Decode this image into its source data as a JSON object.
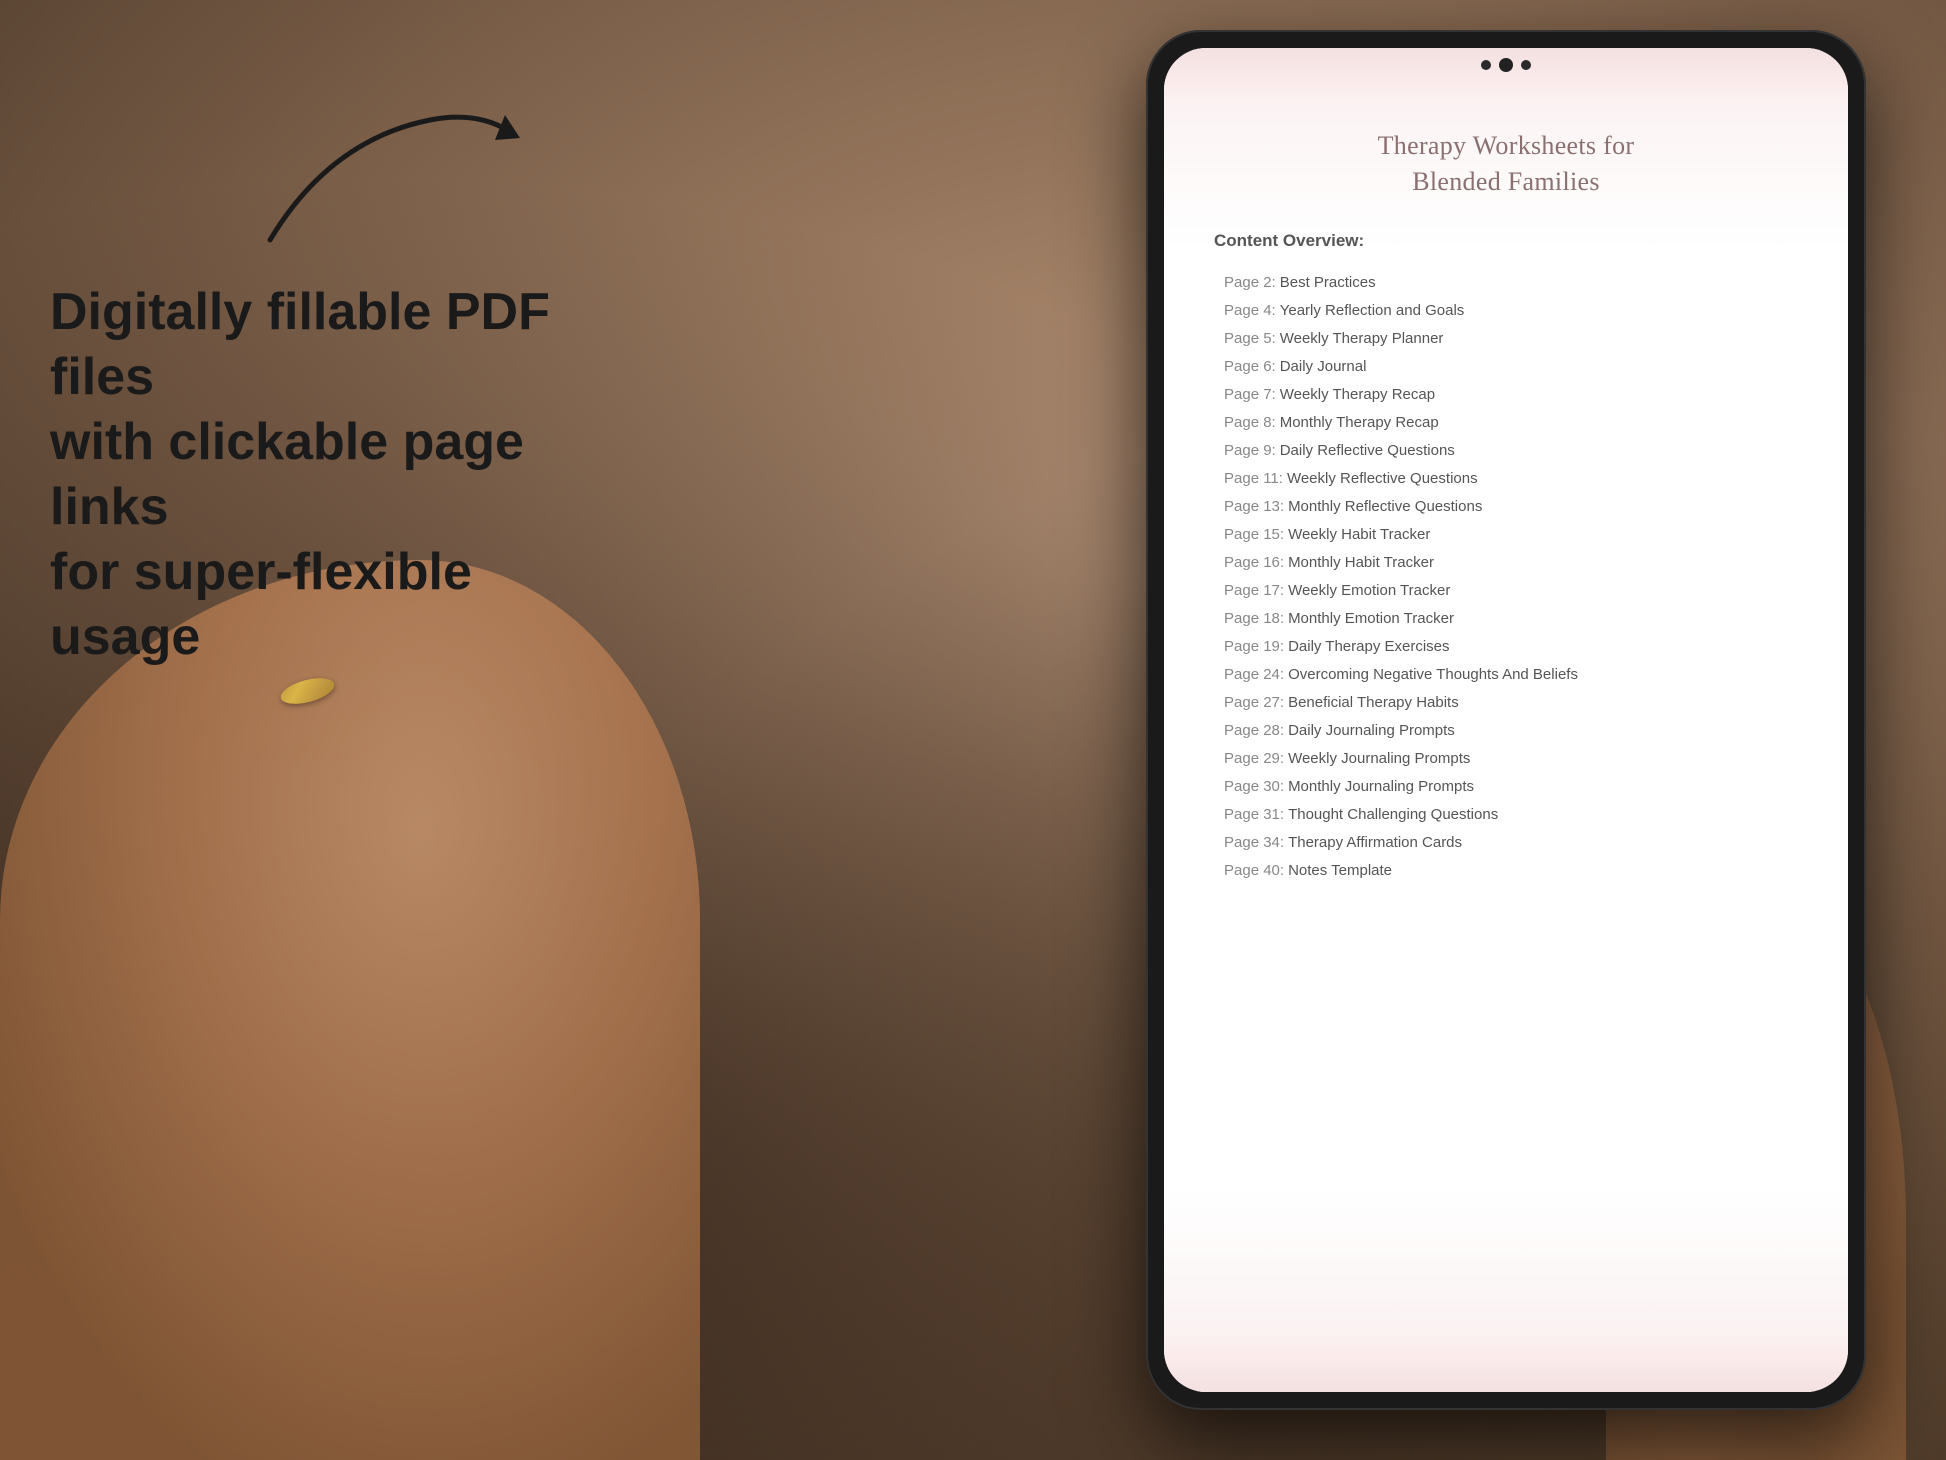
{
  "background": {
    "color": "#a0856a"
  },
  "left_text": {
    "line1": "Digitally fillable PDF files",
    "line2": "with clickable page links",
    "line3": "for super-flexible usage"
  },
  "tablet": {
    "pdf": {
      "title_line1": "Therapy Worksheets for",
      "title_line2": "Blended Families",
      "content_overview_label": "Content Overview:",
      "toc": [
        {
          "page": "Page 2:",
          "title": "Best Practices"
        },
        {
          "page": "Page 4:",
          "title": "Yearly Reflection and Goals"
        },
        {
          "page": "Page 5:",
          "title": "Weekly Therapy Planner"
        },
        {
          "page": "Page 6:",
          "title": "Daily Journal"
        },
        {
          "page": "Page 7:",
          "title": "Weekly Therapy Recap"
        },
        {
          "page": "Page 8:",
          "title": "Monthly Therapy Recap"
        },
        {
          "page": "Page 9:",
          "title": "Daily Reflective Questions"
        },
        {
          "page": "Page 11:",
          "title": "Weekly Reflective Questions"
        },
        {
          "page": "Page 13:",
          "title": "Monthly Reflective Questions"
        },
        {
          "page": "Page 15:",
          "title": "Weekly Habit Tracker"
        },
        {
          "page": "Page 16:",
          "title": "Monthly Habit Tracker"
        },
        {
          "page": "Page 17:",
          "title": "Weekly Emotion Tracker"
        },
        {
          "page": "Page 18:",
          "title": "Monthly Emotion Tracker"
        },
        {
          "page": "Page 19:",
          "title": "Daily Therapy Exercises"
        },
        {
          "page": "Page 24:",
          "title": "Overcoming Negative Thoughts And Beliefs"
        },
        {
          "page": "Page 27:",
          "title": "Beneficial Therapy Habits"
        },
        {
          "page": "Page 28:",
          "title": "Daily Journaling Prompts"
        },
        {
          "page": "Page 29:",
          "title": "Weekly Journaling Prompts"
        },
        {
          "page": "Page 30:",
          "title": "Monthly Journaling Prompts"
        },
        {
          "page": "Page 31:",
          "title": "Thought Challenging Questions"
        },
        {
          "page": "Page 34:",
          "title": "Therapy Affirmation Cards"
        },
        {
          "page": "Page 40:",
          "title": "Notes Template"
        }
      ]
    }
  }
}
